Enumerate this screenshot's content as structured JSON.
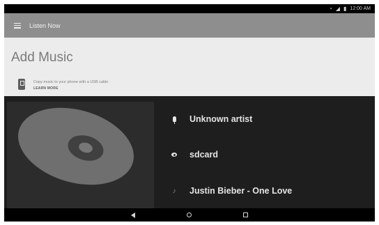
{
  "status_bar": {
    "time": "12:00 AM",
    "icons": [
      "alarm-icon",
      "wifi-icon",
      "battery-icon"
    ]
  },
  "app_bar": {
    "title": "Listen Now",
    "menu_icon": "hamburger-menu-icon"
  },
  "add_music": {
    "title": "Add Music",
    "description": "Copy music to your phone with a USB cable",
    "action_label": "LEARN MORE",
    "icon": "usb-phone-icon"
  },
  "track_info": {
    "artist": "Unknown artist",
    "source": "sdcard",
    "title": "Justin Bieber - One Love"
  },
  "nav_bar": {
    "buttons": [
      "back",
      "home",
      "recent-apps"
    ]
  }
}
